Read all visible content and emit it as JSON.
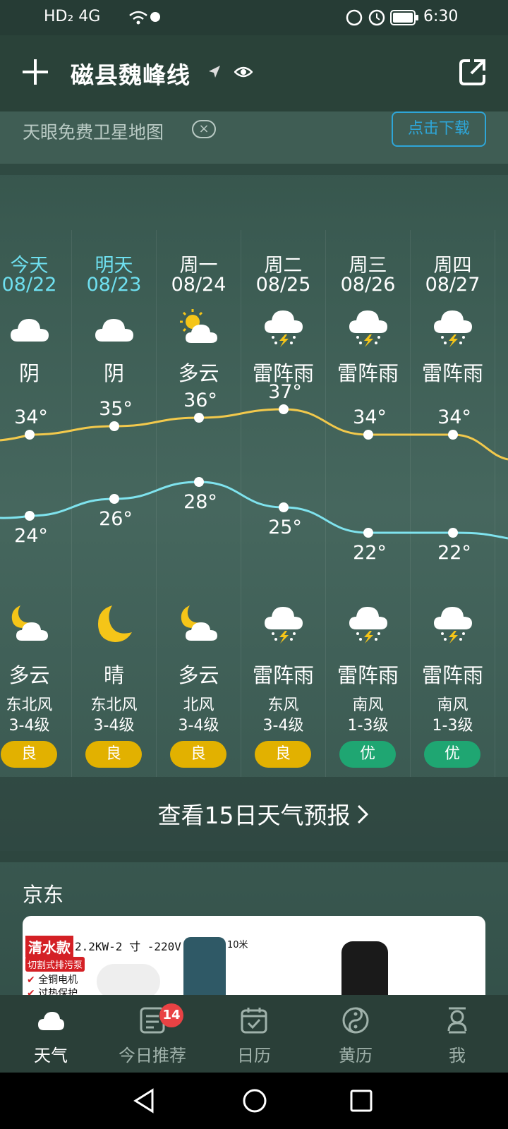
{
  "status_bar": {
    "left_indicators": "HD₂ 4G",
    "time": "6:30"
  },
  "header": {
    "city": "磁县魏峰线"
  },
  "ad": {
    "text": "天眼免费卫星地图",
    "close_label": "×",
    "download_label": "点击下载"
  },
  "forecast": {
    "days": [
      {
        "label": "今天",
        "date": "08/22",
        "day_condition": "阴",
        "day_icon": "cloudy-icon",
        "high": "34°",
        "low": "24°",
        "night_condition": "多云",
        "night_icon": "partly-cloudy-night-icon",
        "wind_direction": "东北风",
        "wind_level": "3-4级",
        "aqi": "良"
      },
      {
        "label": "明天",
        "date": "08/23",
        "day_condition": "阴",
        "day_icon": "cloudy-icon",
        "high": "35°",
        "low": "26°",
        "night_condition": "晴",
        "night_icon": "moon-icon",
        "wind_direction": "东北风",
        "wind_level": "3-4级",
        "aqi": "良"
      },
      {
        "label": "周一",
        "date": "08/24",
        "day_condition": "多云",
        "day_icon": "partly-cloudy-day-icon",
        "high": "36°",
        "low": "28°",
        "night_condition": "多云",
        "night_icon": "partly-cloudy-night-icon",
        "wind_direction": "北风",
        "wind_level": "3-4级",
        "aqi": "良"
      },
      {
        "label": "周二",
        "date": "08/25",
        "day_condition": "雷阵雨",
        "day_icon": "thunderstorm-icon",
        "high": "37°",
        "low": "25°",
        "night_condition": "雷阵雨",
        "night_icon": "thunderstorm-icon",
        "wind_direction": "东风",
        "wind_level": "3-4级",
        "aqi": "良"
      },
      {
        "label": "周三",
        "date": "08/26",
        "day_condition": "雷阵雨",
        "day_icon": "thunderstorm-icon",
        "high": "34°",
        "low": "22°",
        "night_condition": "雷阵雨",
        "night_icon": "thunderstorm-icon",
        "wind_direction": "南风",
        "wind_level": "1-3级",
        "aqi": "优"
      },
      {
        "label": "周四",
        "date": "08/27",
        "day_condition": "雷阵雨",
        "day_icon": "thunderstorm-icon",
        "high": "34°",
        "low": "22°",
        "night_condition": "雷阵雨",
        "night_icon": "thunderstorm-icon",
        "wind_direction": "南风",
        "wind_level": "1-3级",
        "aqi": "优"
      }
    ],
    "high_values": [
      34,
      35,
      36,
      37,
      34,
      34
    ],
    "low_values": [
      24,
      26,
      28,
      25,
      22,
      22
    ],
    "high_line_color": "#f2c94c",
    "low_line_color": "#7fe3ee",
    "aqi_colors": {
      "良": "#e2b100",
      "优": "#1fa672"
    }
  },
  "forecast15": {
    "label": "查看15日天气预报"
  },
  "jd": {
    "title": "京东",
    "ad_tag": "清水款",
    "ad_spec": "2.2KW-2 寸 -220V",
    "ad_length": "10米",
    "ad_feature1": "切割式排污泵",
    "ad_feature2": "全铜电机",
    "ad_feature3": "过热保护"
  },
  "bottom_nav": {
    "items": [
      {
        "label": "天气",
        "icon": "cloud-icon"
      },
      {
        "label": "今日推荐",
        "icon": "news-icon"
      },
      {
        "label": "日历",
        "icon": "calendar-icon"
      },
      {
        "label": "黄历",
        "icon": "yinyang-icon"
      },
      {
        "label": "我",
        "icon": "user-icon"
      }
    ],
    "badge": "14"
  }
}
